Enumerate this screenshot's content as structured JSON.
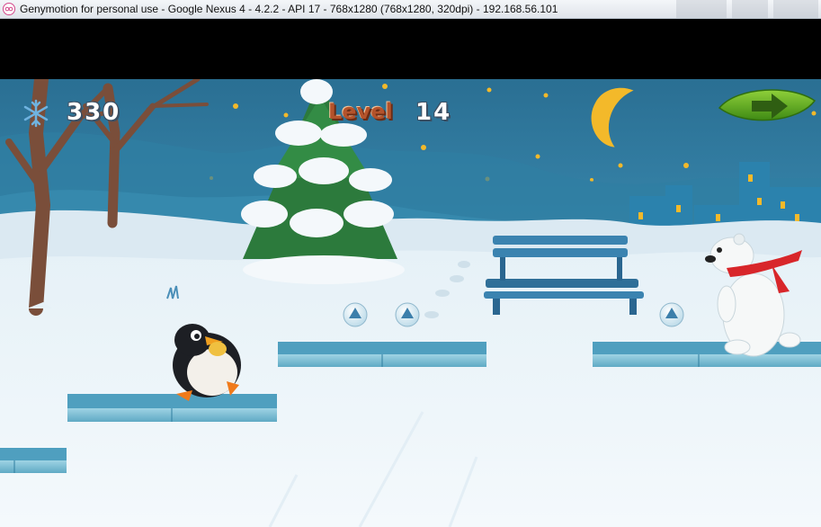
{
  "window": {
    "title": "Genymotion for personal use - Google Nexus 4 - 4.2.2 - API 17 - 768x1280 (768x1280, 320dpi) - 192.168.56.101"
  },
  "hud": {
    "score": "330",
    "level_label": "Level",
    "level_number": "14",
    "next_button_icon": "arrow-right-icon",
    "score_icon": "snowflake-icon"
  },
  "scene": {
    "objects": [
      "penguin-player",
      "polar-bear-enemy",
      "snow-globe-collectible",
      "ice-platform",
      "park-bench",
      "snowy-pine-tree",
      "bare-tree",
      "crescent-moon",
      "city-silhouette"
    ],
    "collectibles_visible": 3,
    "platforms_visible": 4
  },
  "colors": {
    "sky": "#2f7ca0",
    "snow": "#eaf3f8",
    "ice_platform": "#6fb6cf",
    "moon": "#f3b92a",
    "next_button": "#5aa11e",
    "level_text": "#b4532b",
    "bear_scarf": "#d8262a"
  }
}
